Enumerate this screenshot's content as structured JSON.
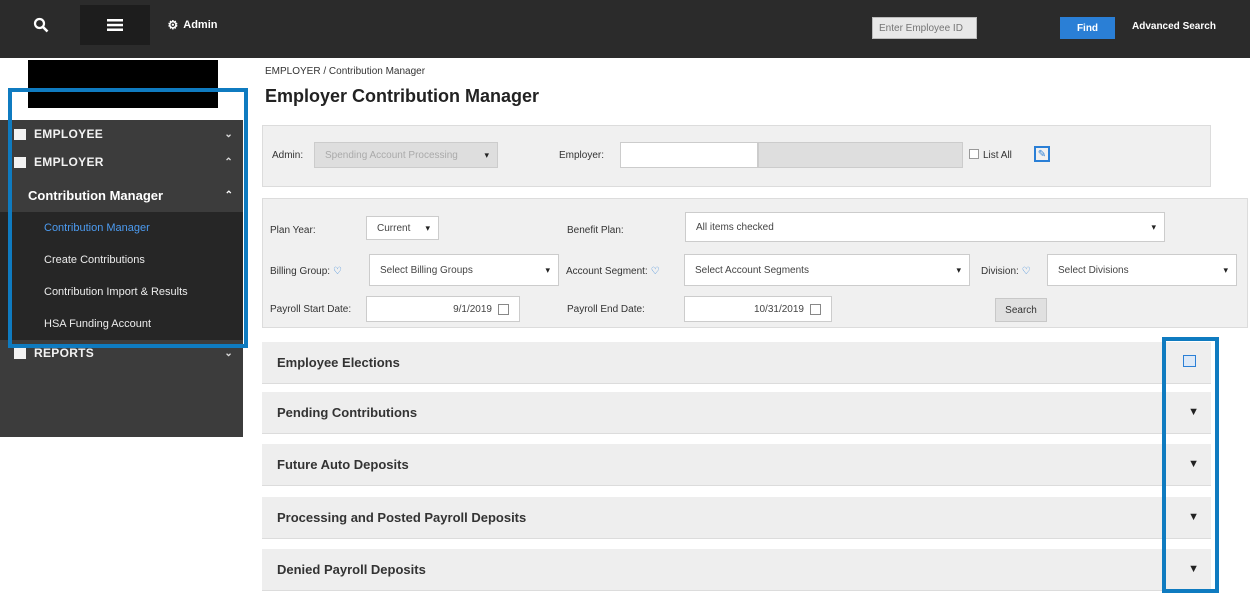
{
  "topbar": {
    "admin_label": "Admin",
    "employee_id_placeholder": "Enter Employee ID",
    "find_label": "Find",
    "advanced_search_label": "Advanced Search"
  },
  "sidebar": {
    "employee_label": "EMPLOYEE",
    "employer_label": "EMPLOYER",
    "contribution_manager_header": "Contribution Manager",
    "sub_items": [
      "Contribution Manager",
      "Create Contributions",
      "Contribution Import & Results",
      "HSA Funding Account"
    ],
    "reports_label": "REPORTS"
  },
  "main": {
    "breadcrumb": "EMPLOYER / Contribution Manager",
    "title": "Employer Contribution Manager",
    "filter1": {
      "admin_label": "Admin:",
      "admin_value": "Spending Account Processing",
      "employer_label": "Employer:",
      "list_all_label": "List All"
    },
    "filter2": {
      "plan_year_label": "Plan Year:",
      "plan_year_value": "Current",
      "benefit_plan_label": "Benefit Plan:",
      "benefit_plan_value": "All items checked",
      "billing_group_label": "Billing Group:",
      "billing_group_value": "Select Billing Groups",
      "account_segment_label": "Account Segment:",
      "account_segment_value": "Select Account Segments",
      "division_label": "Division:",
      "division_value": "Select Divisions",
      "payroll_start_label": "Payroll Start Date:",
      "payroll_start_value": "9/1/2019",
      "payroll_end_label": "Payroll End Date:",
      "payroll_end_value": "10/31/2019",
      "search_label": "Search"
    },
    "accordions": [
      "Employee Elections",
      "Pending Contributions",
      "Future Auto Deposits",
      "Processing and Posted Payroll Deposits",
      "Denied Payroll Deposits"
    ]
  }
}
